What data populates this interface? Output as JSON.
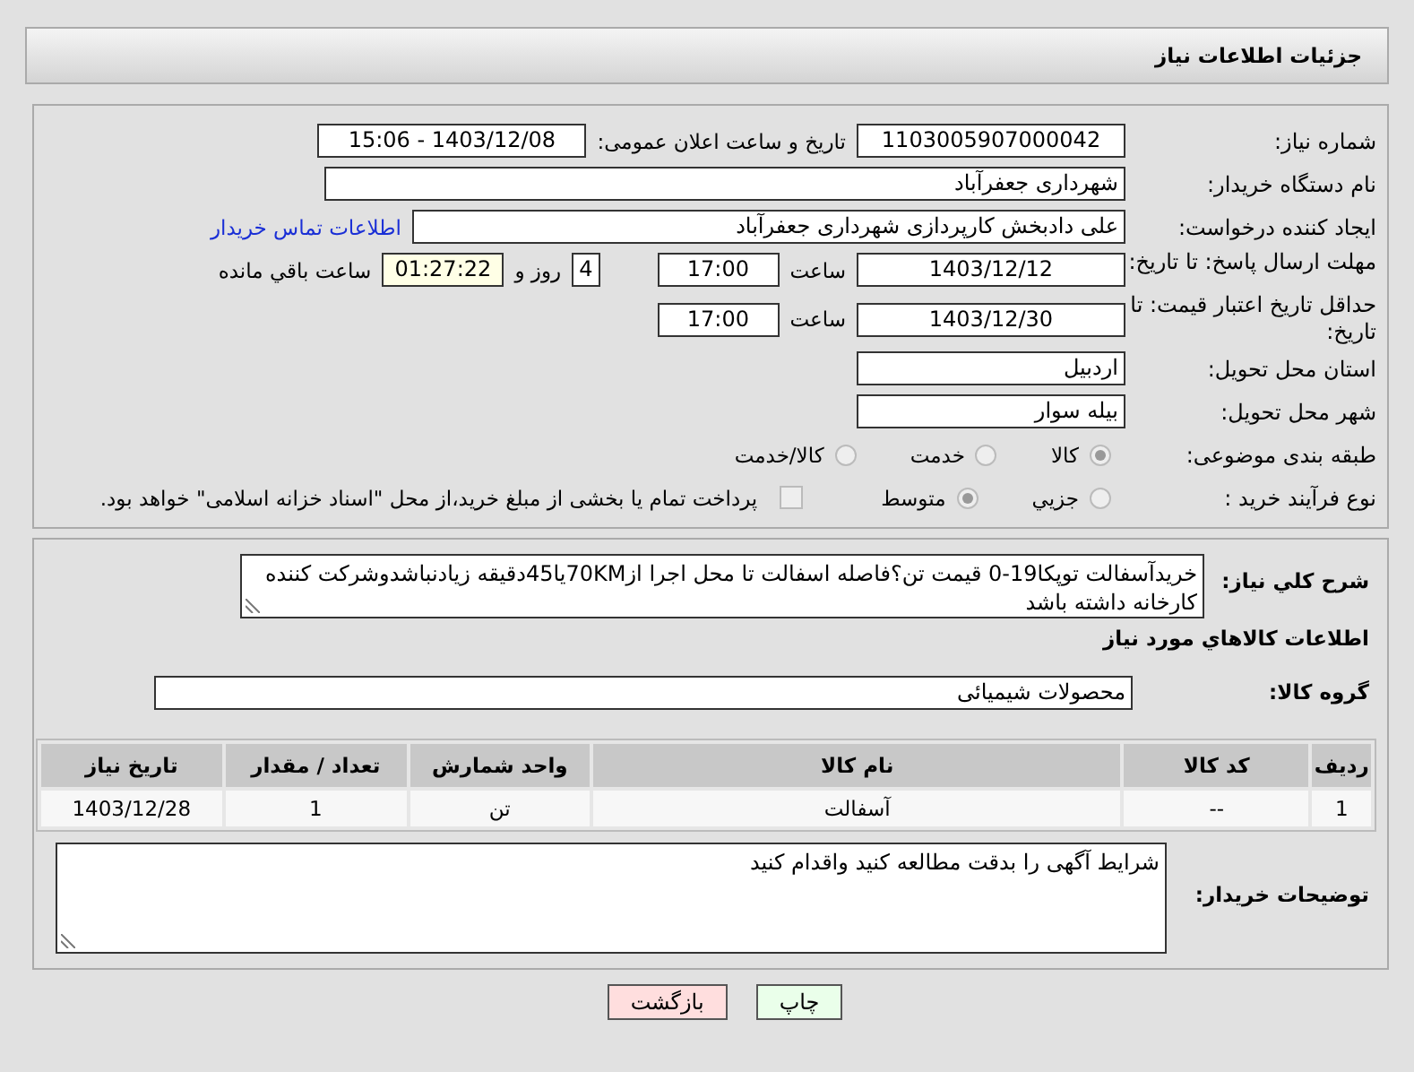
{
  "header": {
    "title": "جزئیات اطلاعات نیاز"
  },
  "need_number": {
    "label": "شماره نیاز:",
    "value": "1103005907000042"
  },
  "announce": {
    "label": "تاریخ و ساعت اعلان عمومی:",
    "value": "1403/12/08 - 15:06"
  },
  "buyer_org": {
    "label": "نام دستگاه خریدار:",
    "value": "شهرداری جعفرآباد"
  },
  "requester": {
    "label": "ایجاد کننده درخواست:",
    "value": "علی دادبخش کارپردازی شهرداری جعفرآباد",
    "link": "اطلاعات تماس خریدار"
  },
  "reply_deadline": {
    "label": "مهلت ارسال پاسخ: تا تاریخ:",
    "date": "1403/12/12",
    "time_label": "ساعت",
    "time": "17:00",
    "days": "4",
    "days_label": "روز و",
    "remaining": "01:27:22",
    "remaining_label": "ساعت باقي مانده"
  },
  "price_validity": {
    "label": "حداقل تاریخ اعتبار قیمت: تا تاریخ:",
    "date": "1403/12/30",
    "time_label": "ساعت",
    "time": "17:00"
  },
  "province": {
    "label": "استان محل تحویل:",
    "value": "اردبیل"
  },
  "city": {
    "label": "شهر محل تحویل:",
    "value": "بیله سوار"
  },
  "category": {
    "label": "طبقه بندی موضوعی:",
    "options": [
      {
        "label": "کالا",
        "selected": true
      },
      {
        "label": "خدمت",
        "selected": false
      },
      {
        "label": "کالا/خدمت",
        "selected": false
      }
    ]
  },
  "process": {
    "label": "نوع فرآیند خرید :",
    "options": [
      {
        "label": "جزیي",
        "selected": false
      },
      {
        "label": "متوسط",
        "selected": true
      }
    ],
    "treasury": {
      "label": "پرداخت تمام یا بخشی از مبلغ خرید،از محل \"اسناد خزانه اسلامی\" خواهد بود.",
      "checked": false
    }
  },
  "description": {
    "label": "شرح کلي نیاز:",
    "value": "خریدآسفالت توپکا19-0 قیمت تن؟فاصله اسفالت تا محل اجرا از70KMیا45دقیقه زیادنباشدوشرکت کننده کارخانه داشته باشد"
  },
  "goods_heading": "اطلاعات کالاهاي مورد نیاز",
  "goods_group": {
    "label": "گروه کالا:",
    "value": "محصولات شیمیائی"
  },
  "table": {
    "columns": [
      "ردیف",
      "کد کالا",
      "نام کالا",
      "واحد شمارش",
      "تعداد / مقدار",
      "تاریخ نیاز"
    ],
    "rows": [
      [
        "1",
        "--",
        "آسفالت",
        "تن",
        "1",
        "1403/12/28"
      ]
    ]
  },
  "buyer_notes": {
    "label": "توضیحات خریدار:",
    "value": "شرایط آگهی را بدقت مطالعه کنید واقدام کنید"
  },
  "buttons": [
    {
      "label": "چاپ",
      "kind": "print"
    },
    {
      "label": "بازگشت",
      "kind": "back"
    }
  ]
}
